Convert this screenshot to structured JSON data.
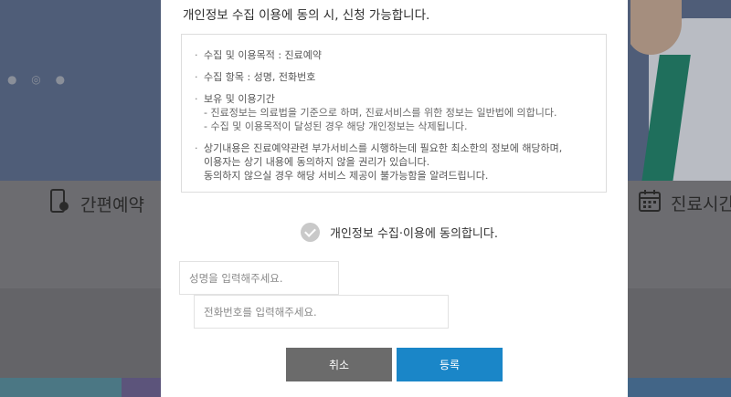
{
  "background": {
    "left_tile_label": "간편예약",
    "right_tile_label": "진료시간",
    "strip_colors": [
      "#3a8a9a",
      "#5a4a8a",
      "#7a5a8a",
      "#2a8a8a",
      "#d08a2a",
      "#2a6aa0"
    ]
  },
  "modal": {
    "title": "개인정보 수집 이용에 동의 시, 신청 가능합니다.",
    "notice": {
      "purpose": "수집 및 이용목적 : 진료예약",
      "items": "수집 항목 : 성명, 전화번호",
      "retention_title": "보유 및 이용기간",
      "retention_line1": "- 진료정보는 의료법을 기준으로 하며, 진료서비스를 위한 정보는 일반법에 의합니다.",
      "retention_line2": "- 수집 및 이용목적이 달성된 경우 해당 개인정보는 삭제됩니다.",
      "refuse_line1": "상기내용은 진료예약관련 부가서비스를 시행하는데 필요한 최소한의 정보에 해당하며,",
      "refuse_line2": "이용자는 상기 내용에 동의하지 않을 권리가 있습니다.",
      "refuse_line3": "동의하지 않으실 경우 해당 서비스 제공이 불가능함을 알려드립니다."
    },
    "agree_label": "개인정보 수집·이용에 동의합니다.",
    "agree_checked": true,
    "name_placeholder": "성명을 입력해주세요.",
    "phone_placeholder": "전화번호를 입력해주세요.",
    "cancel_label": "취소",
    "submit_label": "등록"
  }
}
